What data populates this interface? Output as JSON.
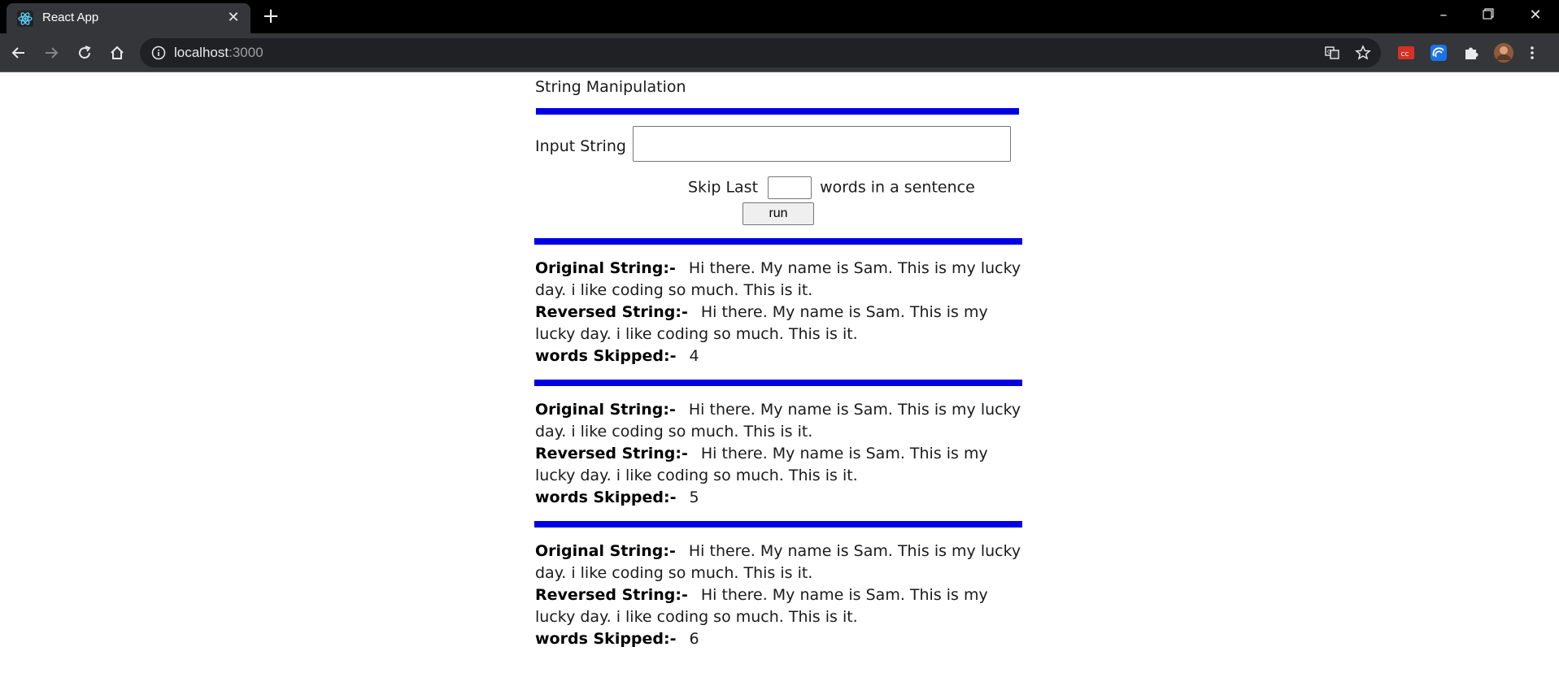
{
  "browser": {
    "tab_title": "React App",
    "url_host": "localhost",
    "url_port": ":3000"
  },
  "app": {
    "title": "String Manipulation",
    "input_label": "Input String",
    "input_value": "",
    "skip_prefix": "Skip Last",
    "skip_value": "",
    "skip_suffix": "words in a sentence",
    "run_label": "run",
    "original_label": "Original String:-",
    "reversed_label": "Reversed String:-",
    "skipped_label": "words Skipped:-",
    "results": [
      {
        "original": "Hi there. My name is Sam. This is my lucky day. i like coding so much. This is it.",
        "reversed": "Hi there. My name is Sam. This is my lucky day. i like coding so much. This is it.",
        "skipped": "4"
      },
      {
        "original": "Hi there. My name is Sam. This is my lucky day. i like coding so much. This is it.",
        "reversed": "Hi there. My name is Sam. This is my lucky day. i like coding so much. This is it.",
        "skipped": "5"
      },
      {
        "original": "Hi there. My name is Sam. This is my lucky day. i like coding so much. This is it.",
        "reversed": "Hi there. My name is Sam. This is my lucky day. i like coding so much. This is it.",
        "skipped": "6"
      }
    ]
  },
  "colors": {
    "divider": "#0000e6",
    "chrome_bg": "#35363a"
  }
}
